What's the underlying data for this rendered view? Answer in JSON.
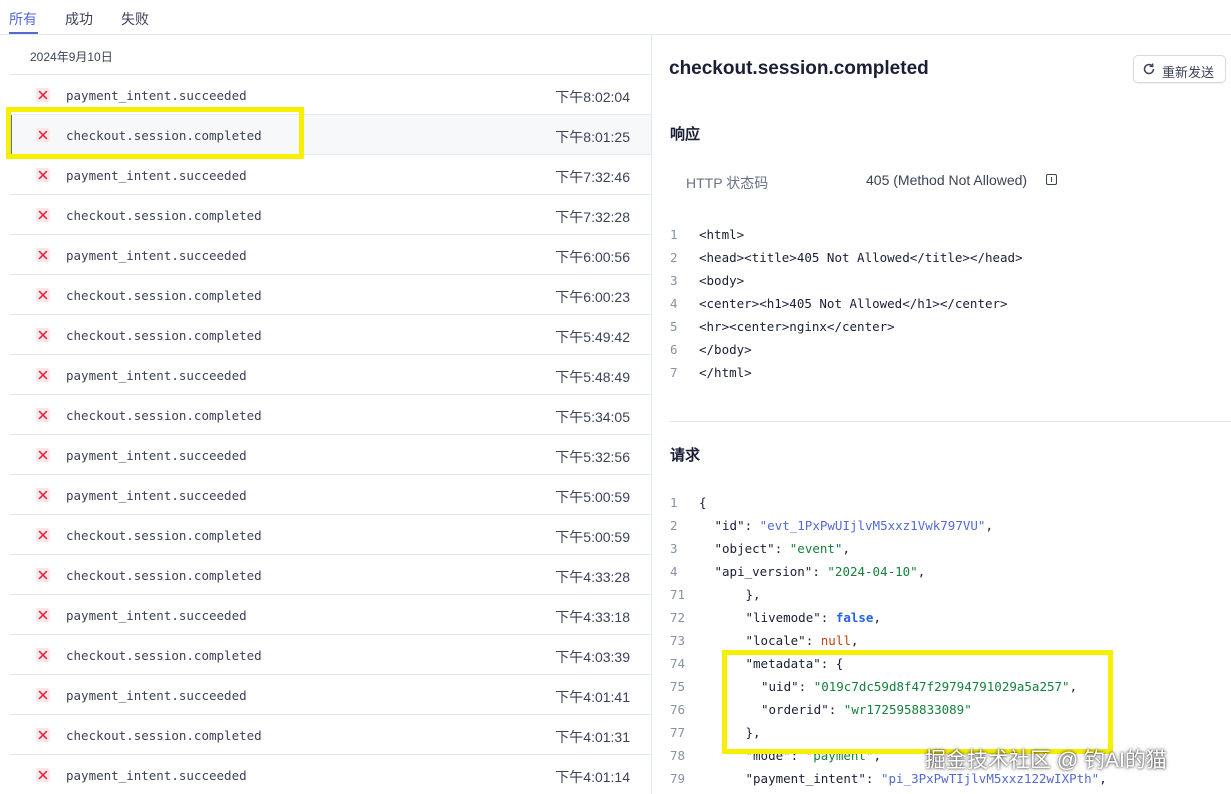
{
  "tabs": [
    {
      "label": "所有",
      "active": true
    },
    {
      "label": "成功",
      "active": false
    },
    {
      "label": "失败",
      "active": false
    }
  ],
  "list": {
    "date": "2024年9月10日",
    "events": [
      {
        "name": "payment_intent.succeeded",
        "time": "下午8:02:04",
        "status": "failed"
      },
      {
        "name": "checkout.session.completed",
        "time": "下午8:01:25",
        "status": "failed",
        "selected": true
      },
      {
        "name": "payment_intent.succeeded",
        "time": "下午7:32:46",
        "status": "failed"
      },
      {
        "name": "checkout.session.completed",
        "time": "下午7:32:28",
        "status": "failed"
      },
      {
        "name": "payment_intent.succeeded",
        "time": "下午6:00:56",
        "status": "failed"
      },
      {
        "name": "checkout.session.completed",
        "time": "下午6:00:23",
        "status": "failed"
      },
      {
        "name": "checkout.session.completed",
        "time": "下午5:49:42",
        "status": "failed"
      },
      {
        "name": "payment_intent.succeeded",
        "time": "下午5:48:49",
        "status": "failed"
      },
      {
        "name": "checkout.session.completed",
        "time": "下午5:34:05",
        "status": "failed"
      },
      {
        "name": "payment_intent.succeeded",
        "time": "下午5:32:56",
        "status": "failed"
      },
      {
        "name": "payment_intent.succeeded",
        "time": "下午5:00:59",
        "status": "failed"
      },
      {
        "name": "checkout.session.completed",
        "time": "下午5:00:59",
        "status": "failed"
      },
      {
        "name": "checkout.session.completed",
        "time": "下午4:33:28",
        "status": "failed"
      },
      {
        "name": "payment_intent.succeeded",
        "time": "下午4:33:18",
        "status": "failed"
      },
      {
        "name": "checkout.session.completed",
        "time": "下午4:03:39",
        "status": "failed"
      },
      {
        "name": "payment_intent.succeeded",
        "time": "下午4:01:41",
        "status": "failed"
      },
      {
        "name": "checkout.session.completed",
        "time": "下午4:01:31",
        "status": "failed"
      },
      {
        "name": "payment_intent.succeeded",
        "time": "下午4:01:14",
        "status": "failed"
      }
    ]
  },
  "detail": {
    "title": "checkout.session.completed",
    "resend_label": "重新发送",
    "response": {
      "heading": "响应",
      "status_label": "HTTP 状态码",
      "status_value": "405 (Method Not Allowed)",
      "body_lines": [
        {
          "n": "1",
          "text": "<html>"
        },
        {
          "n": "2",
          "text": "<head><title>405 Not Allowed</title></head>"
        },
        {
          "n": "3",
          "text": "<body>"
        },
        {
          "n": "4",
          "text": "<center><h1>405 Not Allowed</h1></center>"
        },
        {
          "n": "5",
          "text": "<hr><center>nginx</center>"
        },
        {
          "n": "6",
          "text": "</body>"
        },
        {
          "n": "7",
          "text": "</html>"
        }
      ]
    },
    "request": {
      "heading": "请求",
      "body_lines": [
        {
          "n": "1",
          "indent": 0,
          "parts": [
            [
              "k",
              "{"
            ]
          ]
        },
        {
          "n": "2",
          "indent": 1,
          "parts": [
            [
              "k",
              "\"id\": "
            ],
            [
              "s",
              "\"evt_1PxPwUIjlvM5xxz1Vwk797VU\""
            ],
            [
              "k",
              ","
            ]
          ]
        },
        {
          "n": "3",
          "indent": 1,
          "parts": [
            [
              "k",
              "\"object\": "
            ],
            [
              "g",
              "\"event\""
            ],
            [
              "k",
              ","
            ]
          ]
        },
        {
          "n": "4",
          "indent": 1,
          "parts": [
            [
              "k",
              "\"api_version\": "
            ],
            [
              "g",
              "\"2024-04-10\""
            ],
            [
              "k",
              ","
            ]
          ]
        },
        {
          "n": "71",
          "indent": 3,
          "parts": [
            [
              "k",
              "},"
            ]
          ]
        },
        {
          "n": "72",
          "indent": 3,
          "parts": [
            [
              "k",
              "\"livemode\": "
            ],
            [
              "b",
              "false"
            ],
            [
              "k",
              ","
            ]
          ]
        },
        {
          "n": "73",
          "indent": 3,
          "parts": [
            [
              "k",
              "\"locale\": "
            ],
            [
              "n",
              "null"
            ],
            [
              "k",
              ","
            ]
          ]
        },
        {
          "n": "74",
          "indent": 3,
          "parts": [
            [
              "k",
              "\"metadata\": {"
            ]
          ]
        },
        {
          "n": "75",
          "indent": 4,
          "parts": [
            [
              "k",
              "\"uid\": "
            ],
            [
              "g",
              "\"019c7dc59d8f47f29794791029a5a257\""
            ],
            [
              "k",
              ","
            ]
          ]
        },
        {
          "n": "76",
          "indent": 4,
          "parts": [
            [
              "k",
              "\"orderid\": "
            ],
            [
              "g",
              "\"wr1725958833089\""
            ]
          ]
        },
        {
          "n": "77",
          "indent": 3,
          "parts": [
            [
              "k",
              "},"
            ]
          ]
        },
        {
          "n": "78",
          "indent": 3,
          "parts": [
            [
              "k",
              "\"mode\": "
            ],
            [
              "g",
              "\"payment\""
            ],
            [
              "k",
              ","
            ]
          ]
        },
        {
          "n": "79",
          "indent": 3,
          "parts": [
            [
              "k",
              "\"payment_intent\": "
            ],
            [
              "s",
              "\"pi_3PxPwTIjlvM5xxz122wIXPth\""
            ],
            [
              "k",
              ","
            ]
          ]
        }
      ]
    }
  },
  "watermark": "掘金技术社区 @ 钓AI的猫",
  "colors": {
    "accent": "#5469d4",
    "error": "#df1b41",
    "highlight": "#f7ef00"
  }
}
